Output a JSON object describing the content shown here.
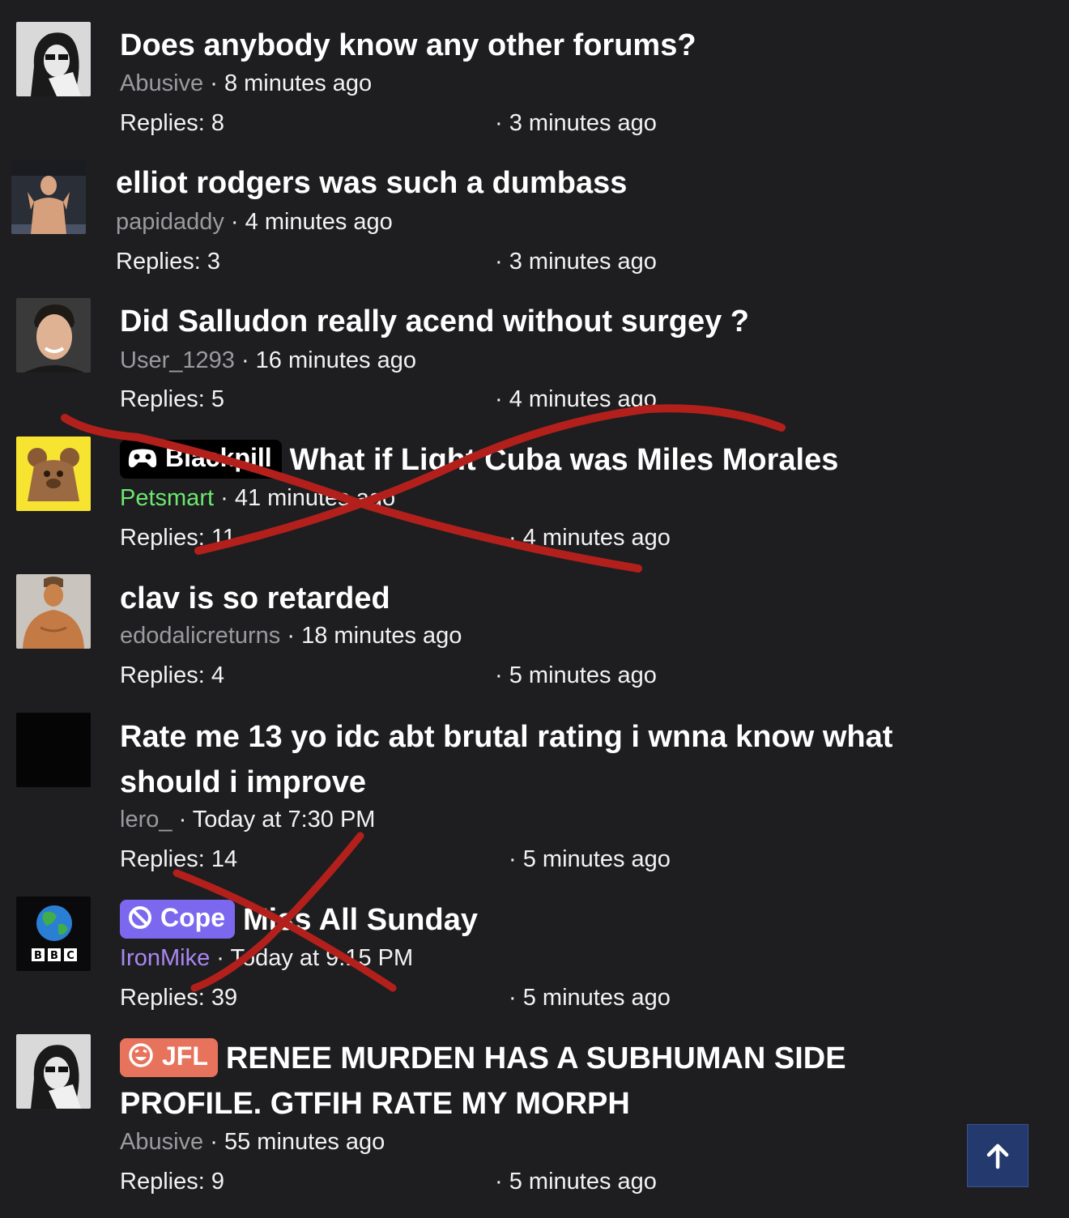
{
  "threads": [
    {
      "title": "Does anybody know any other forums?",
      "author": "Abusive",
      "posted": "8 minutes ago",
      "replies": "Replies: 8",
      "last_activity": "3 minutes ago",
      "avatar_icon": "bw-sunglasses-avatar"
    },
    {
      "title": "elliot rodgers was such a dumbass",
      "author": "papidaddy",
      "posted": "4 minutes ago",
      "replies": "Replies: 3",
      "last_activity": "3 minutes ago",
      "avatar_icon": "fighter-photo-avatar"
    },
    {
      "title": "Did Salludon really acend without surgey ?",
      "author": "User_1293",
      "posted": "16 minutes ago",
      "replies": "Replies: 5",
      "last_activity": "4 minutes ago",
      "avatar_icon": "smiling-man-avatar"
    },
    {
      "prefix": "Blackpill",
      "title": "What if Light Cuba was Miles Morales",
      "author": "Petsmart",
      "posted": "41 minutes ago",
      "replies": "Replies: 11",
      "last_activity": "4 minutes ago",
      "avatar_icon": "cartoon-bear-avatar"
    },
    {
      "title": "clav is so retarded",
      "author": "edodalicreturns",
      "posted": "18 minutes ago",
      "replies": "Replies: 4",
      "last_activity": "5 minutes ago",
      "avatar_icon": "muscle-man-avatar"
    },
    {
      "title": "Rate me 13 yo idc abt brutal rating i wnna know what should i improve",
      "author": "lero_",
      "posted": "Today at 7:30 PM",
      "replies": "Replies: 14",
      "last_activity": "5 minutes ago",
      "avatar_icon": "black-avatar"
    },
    {
      "prefix": "Cope",
      "title": "Miss All Sunday",
      "author": "IronMike",
      "posted": "Today at 9:15 PM",
      "replies": "Replies: 39",
      "last_activity": "5 minutes ago",
      "avatar_icon": "bbc-globe-avatar"
    },
    {
      "prefix": "JFL",
      "title": "RENEE MURDEN HAS A SUBHUMAN SIDE PROFILE. GTFIH RATE MY MORPH",
      "author": "Abusive",
      "posted": "55 minutes ago",
      "replies": "Replies: 9",
      "last_activity": "5 minutes ago",
      "avatar_icon": "bw-sunglasses-avatar"
    }
  ],
  "separator": "·",
  "scroll_top": {
    "icon": "arrow-up-icon",
    "background": "#243a6e"
  },
  "annotations": {
    "color": "#b3201c",
    "marks": [
      "cross-out-x-blackpill-thread",
      "cross-out-x-cope-thread"
    ]
  }
}
